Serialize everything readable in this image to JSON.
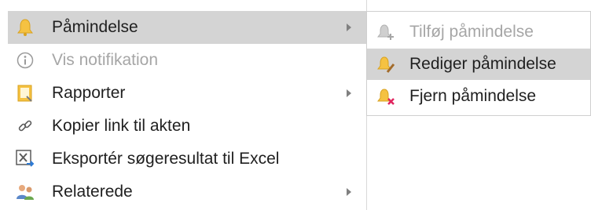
{
  "menu": {
    "items": [
      {
        "label": "Påmindelse",
        "icon": "bell-icon",
        "has_submenu": true,
        "state": "highlighted"
      },
      {
        "label": "Vis notifikation",
        "icon": "info-icon",
        "has_submenu": false,
        "state": "disabled"
      },
      {
        "label": "Rapporter",
        "icon": "report-icon",
        "has_submenu": true,
        "state": "normal"
      },
      {
        "label": "Kopier link til akten",
        "icon": "link-icon",
        "has_submenu": false,
        "state": "normal"
      },
      {
        "label": "Eksportér søgeresultat til Excel",
        "icon": "excel-export-icon",
        "has_submenu": false,
        "state": "normal"
      },
      {
        "label": "Relaterede",
        "icon": "people-icon",
        "has_submenu": true,
        "state": "normal"
      }
    ]
  },
  "submenu": {
    "items": [
      {
        "label": "Tilføj påmindelse",
        "icon": "bell-add-icon",
        "state": "disabled"
      },
      {
        "label": "Rediger påmindelse",
        "icon": "bell-edit-icon",
        "state": "highlighted"
      },
      {
        "label": "Fjern påmindelse",
        "icon": "bell-remove-icon",
        "state": "normal"
      }
    ]
  },
  "colors": {
    "highlight": "#d4d4d4",
    "text": "#1f1f1f",
    "disabled_text": "#a6a6a6",
    "bell": "#f5c242",
    "remove_x": "#e0245e"
  }
}
